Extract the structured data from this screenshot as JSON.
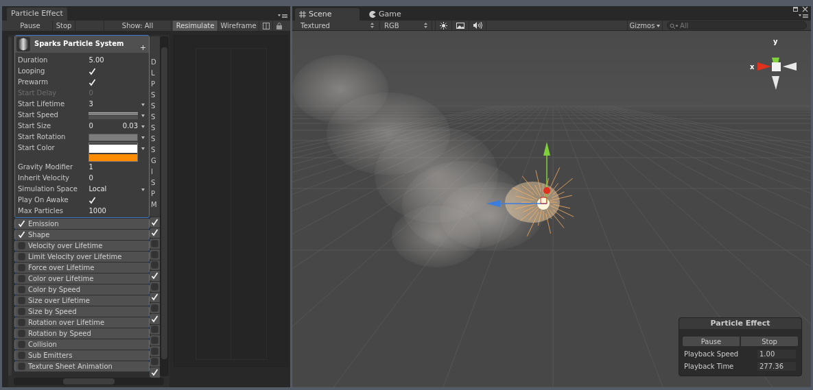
{
  "panel": {
    "tab": "Particle Effect",
    "toolbar": [
      {
        "label": "Pause",
        "selected": false
      },
      {
        "label": "Stop",
        "selected": false
      },
      {
        "label": "Show: All",
        "selected": false
      },
      {
        "label": "Resimulate",
        "selected": true
      },
      {
        "label": "Wireframe",
        "selected": false
      }
    ]
  },
  "particle_system": {
    "title": "Sparks Particle System",
    "properties": [
      {
        "kind": "text",
        "label": "Duration",
        "value": "5.00",
        "disabled": false,
        "menu": false
      },
      {
        "kind": "check",
        "label": "Looping",
        "checked": true,
        "disabled": false,
        "menu": false
      },
      {
        "kind": "check",
        "label": "Prewarm",
        "checked": true,
        "disabled": false,
        "menu": false
      },
      {
        "kind": "text",
        "label": "Start Delay",
        "value": "0",
        "disabled": true,
        "menu": false
      },
      {
        "kind": "text",
        "label": "Start Lifetime",
        "value": "3",
        "disabled": false,
        "menu": true
      },
      {
        "kind": "curve",
        "label": "Start Speed",
        "disabled": false,
        "menu": true
      },
      {
        "kind": "range",
        "label": "Start Size",
        "min": "0",
        "max": "0.03",
        "disabled": false,
        "menu": true
      },
      {
        "kind": "bar",
        "label": "Start Rotation",
        "disabled": false,
        "menu": true
      },
      {
        "kind": "color",
        "label": "Start Color",
        "color": "#ff8c00",
        "disabled": false,
        "menu": true
      },
      {
        "kind": "text",
        "label": "Gravity Modifier",
        "value": "1",
        "disabled": false,
        "menu": false
      },
      {
        "kind": "text",
        "label": "Inherit Velocity",
        "value": "0",
        "disabled": false,
        "menu": false
      },
      {
        "kind": "text",
        "label": "Simulation Space",
        "value": "Local",
        "disabled": false,
        "menu": true
      },
      {
        "kind": "check",
        "label": "Play On Awake",
        "checked": true,
        "disabled": false,
        "menu": false
      },
      {
        "kind": "text",
        "label": "Max Particles",
        "value": "1000",
        "disabled": false,
        "menu": false
      }
    ],
    "modules": [
      {
        "label": "Emission",
        "checked": true
      },
      {
        "label": "Shape",
        "checked": true
      },
      {
        "label": "Velocity over Lifetime",
        "checked": false
      },
      {
        "label": "Limit Velocity over Lifetime",
        "checked": false
      },
      {
        "label": "Force over Lifetime",
        "checked": false
      },
      {
        "label": "Color over Lifetime",
        "checked": false
      },
      {
        "label": "Color by Speed",
        "checked": false
      },
      {
        "label": "Size over Lifetime",
        "checked": false
      },
      {
        "label": "Size by Speed",
        "checked": false
      },
      {
        "label": "Rotation over Lifetime",
        "checked": false
      },
      {
        "label": "Rotation by Speed",
        "checked": false
      },
      {
        "label": "Collision",
        "checked": false
      },
      {
        "label": "Sub Emitters",
        "checked": false
      },
      {
        "label": "Texture Sheet Animation",
        "checked": false
      }
    ]
  },
  "column_2": {
    "labels": [
      "D",
      "L",
      "P",
      "S",
      "S",
      "S",
      "S",
      "S",
      "S",
      "G",
      "I",
      "S",
      "P",
      "M"
    ],
    "modules": [
      {
        "checked": true
      },
      {
        "checked": true
      },
      {
        "checked": false
      },
      {
        "checked": false
      },
      {
        "checked": false
      },
      {
        "checked": true
      },
      {
        "checked": false
      },
      {
        "checked": true
      },
      {
        "checked": false
      },
      {
        "checked": true
      },
      {
        "checked": false
      },
      {
        "checked": false
      },
      {
        "checked": false
      },
      {
        "checked": false
      },
      {
        "checked": true
      }
    ]
  },
  "scene": {
    "tabs": [
      {
        "label": "Scene",
        "selected": true
      },
      {
        "label": "Game",
        "selected": false
      }
    ],
    "draw_mode": "Textured",
    "channel": "RGB",
    "toggles": [
      {
        "on": false
      },
      {
        "on": false
      },
      {
        "on": false
      }
    ],
    "gizmos": "Gizmos",
    "search_placeholder": "All",
    "axis_labels": [
      "x",
      "y"
    ],
    "overlay": {
      "title": "Particle Effect",
      "buttons": [
        "Pause",
        "Stop"
      ],
      "fields": [
        {
          "label": "Playback Speed",
          "value": "1.00"
        },
        {
          "label": "Playback Time",
          "value": "277.36"
        }
      ]
    }
  }
}
